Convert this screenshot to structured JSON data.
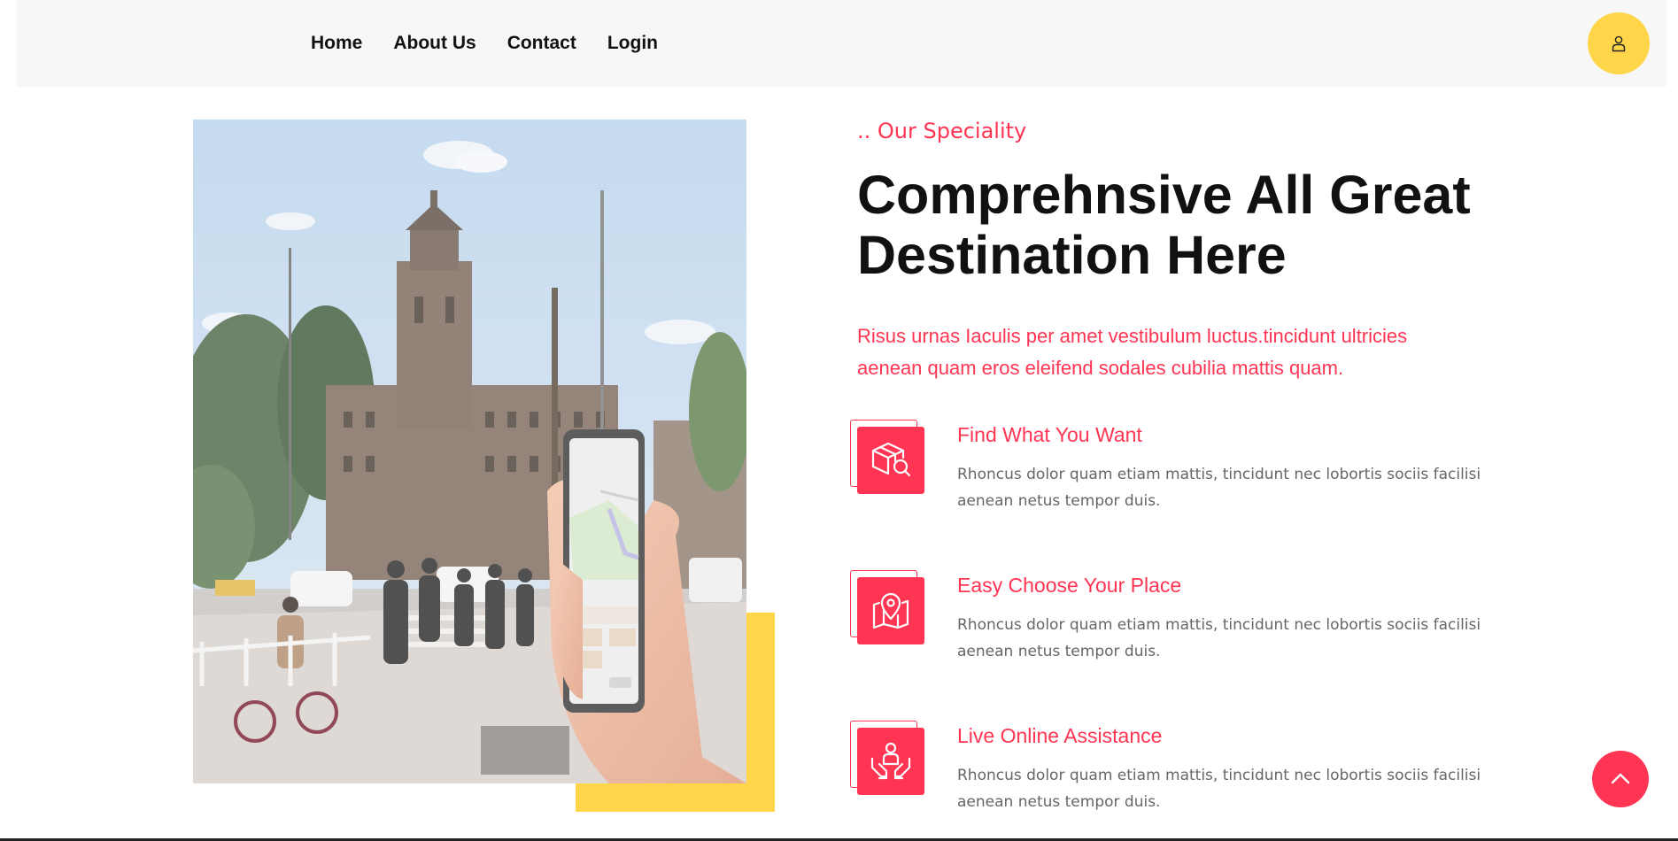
{
  "nav": {
    "items": [
      "Home",
      "About Us",
      "Contact",
      "Login"
    ]
  },
  "header": {
    "user_icon": "user-icon"
  },
  "hero_image": {
    "description_icon": "photo"
  },
  "section": {
    "eyebrow": ".. Our Speciality",
    "title": "Comprehnsive All Great Destination Here",
    "description": "Risus urnas Iaculis per amet vestibulum luctus.tincidunt ultricies aenean quam eros eleifend sodales cubilia mattis quam."
  },
  "features": [
    {
      "icon": "package-search-icon",
      "title": "Find What You Want",
      "text": "Rhoncus dolor quam etiam mattis, tincidunt nec lobortis sociis facilisi aenean netus tempor duis."
    },
    {
      "icon": "map-pin-icon",
      "title": "Easy Choose Your Place",
      "text": "Rhoncus dolor quam etiam mattis, tincidunt nec lobortis sociis facilisi aenean netus tempor duis."
    },
    {
      "icon": "assistance-icon",
      "title": "Live Online Assistance",
      "text": "Rhoncus dolor quam etiam mattis, tincidunt nec lobortis sociis facilisi aenean netus tempor duis."
    }
  ],
  "scroll_top": {
    "icon": "chevron-up-icon"
  },
  "colors": {
    "accent": "#ff3553",
    "yellow": "#ffd54a",
    "heading": "#111111",
    "body_text": "#666666",
    "header_bg": "#f7f7f7"
  }
}
